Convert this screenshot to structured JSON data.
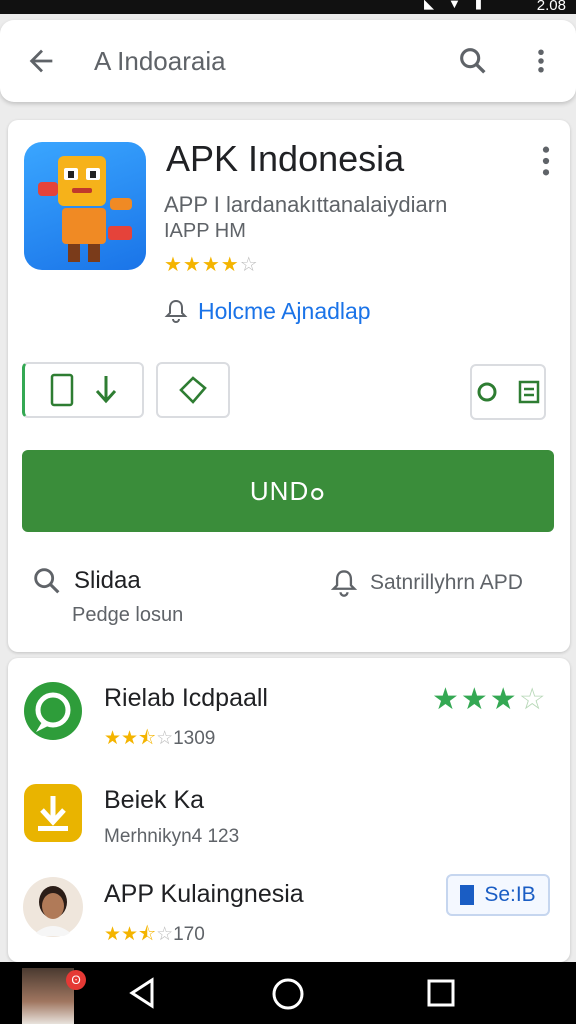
{
  "status_bar": {
    "time": "2.08",
    "icons": [
      "signal-icon",
      "wifi-icon",
      "battery-icon"
    ]
  },
  "search_bar": {
    "query": "A Indoaraia",
    "icons": {
      "back": "back-arrow-icon",
      "search": "search-icon",
      "more": "more-vert-icon"
    }
  },
  "app": {
    "title": "APK Indonesia",
    "subtitle": "APP I lardanakıttanalaiydiarn",
    "subtitle2": "IAPP HM",
    "rating_stars": 4,
    "rating_max": 5,
    "developer": "Holcme Ajnadlap",
    "buttons": {
      "a_icons": [
        "phone-icon",
        "download-arrow-icon"
      ],
      "b_icon": "tag-icon",
      "c_icons": [
        "record-icon",
        "list-icon"
      ]
    },
    "install_label": "UND๐",
    "info_left_title": "Slidaa",
    "info_left_sub": "Pedge losun",
    "info_right_text": "Satnrillyhrn APD"
  },
  "list": [
    {
      "title": "Rielab Icdpaall",
      "stars": 3,
      "half": true,
      "count": "1309",
      "right_stars": 3,
      "right_max": 4,
      "icon": "chat-app-icon",
      "color": "#2e9d3a"
    },
    {
      "title": "Beiek Ka",
      "sub": "Merhnikyn4 123",
      "icon": "download-app-icon",
      "color": "#e9b400"
    },
    {
      "title": "APP Kulaingnesia",
      "stars": 2,
      "half": true,
      "count": "170",
      "badge": "Se:IB",
      "icon": "avatar-icon"
    }
  ],
  "colors": {
    "accent_green": "#3a8d3a",
    "link_blue": "#1a73e8",
    "star_yellow": "#f4b400"
  }
}
